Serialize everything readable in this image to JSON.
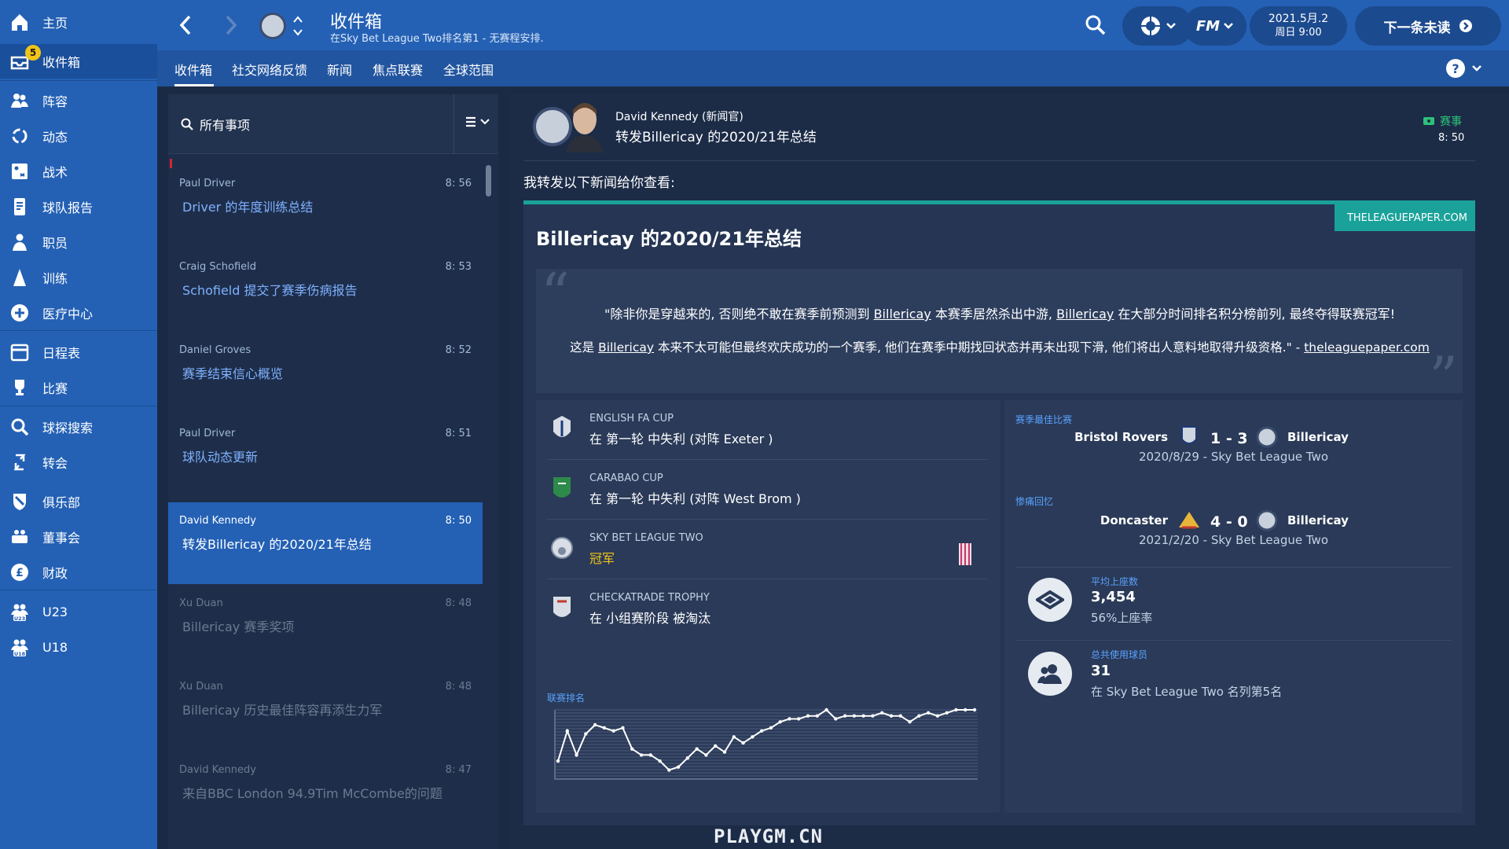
{
  "sidebar": {
    "items": [
      {
        "label": "主页",
        "icon": "home-icon"
      },
      {
        "label": "收件箱",
        "icon": "inbox-icon",
        "badge": "5"
      },
      {
        "label": "阵容",
        "icon": "squad-icon"
      },
      {
        "label": "动态",
        "icon": "dynamics-icon"
      },
      {
        "label": "战术",
        "icon": "tactics-icon"
      },
      {
        "label": "球队报告",
        "icon": "report-icon"
      },
      {
        "label": "职员",
        "icon": "staff-icon"
      },
      {
        "label": "训练",
        "icon": "training-icon"
      },
      {
        "label": "医疗中心",
        "icon": "medical-icon"
      },
      {
        "label": "日程表",
        "icon": "calendar-icon"
      },
      {
        "label": "比赛",
        "icon": "trophy-icon"
      },
      {
        "label": "球探搜索",
        "icon": "search-icon"
      },
      {
        "label": "转会",
        "icon": "transfer-icon"
      },
      {
        "label": "俱乐部",
        "icon": "club-icon"
      },
      {
        "label": "董事会",
        "icon": "board-icon"
      },
      {
        "label": "财政",
        "icon": "finance-icon"
      },
      {
        "label": "U23",
        "icon": "u23-icon"
      },
      {
        "label": "U18",
        "icon": "u18-icon"
      }
    ]
  },
  "header": {
    "title": "收件箱",
    "subtitle": "在Sky Bet League Two排名第1 - 无赛程安排.",
    "date": "2021.5月.2",
    "time": "周日 9:00",
    "next_label": "下一条未读",
    "fm_label": "FM"
  },
  "tabs": [
    "收件箱",
    "社交网络反馈",
    "新闻",
    "焦点联赛",
    "全球范围"
  ],
  "inbox": {
    "search_label": "所有事项",
    "messages": [
      {
        "from": "Paul Driver",
        "time": "8: 56",
        "subject": "Driver 的年度训练总结",
        "state": "unread"
      },
      {
        "from": "Craig Schofield",
        "time": "8: 53",
        "subject": "Schofield 提交了赛季伤病报告",
        "state": "unread"
      },
      {
        "from": "Daniel Groves",
        "time": "8: 52",
        "subject": "赛季结束信心概览",
        "state": "unread"
      },
      {
        "from": "Paul Driver",
        "time": "8: 51",
        "subject": "球队动态更新",
        "state": "unread"
      },
      {
        "from": "David Kennedy",
        "time": "8: 50",
        "subject": "转发Billericay 的2020/21年总结",
        "state": "selected"
      },
      {
        "from": "Xu Duan",
        "time": "8: 48",
        "subject": "Billericay 赛季奖项",
        "state": "read"
      },
      {
        "from": "Xu Duan",
        "time": "8: 48",
        "subject": "Billericay 历史最佳阵容再添生力军",
        "state": "read"
      },
      {
        "from": "David Kennedy",
        "time": "8: 47",
        "subject": "来自BBC London 94.9Tim McCombe的问题",
        "state": "read"
      }
    ]
  },
  "detail": {
    "sender": "David Kennedy (新闻官)",
    "subject": "转发Billericay 的2020/21年总结",
    "category": "赛事",
    "time": "8: 50",
    "intro": "我转发以下新闻给你查看:",
    "source": "THELEAGUEPAPER.COM",
    "article_title": "Billericay 的2020/21年总结",
    "quote1_parts": [
      "\"除非你是穿越来的, 否则绝不敢在赛季前预测到 ",
      "Billericay",
      " 本赛季居然杀出中游, ",
      "Billericay",
      " 在大部分时间排名积分榜前列, 最终夺得联赛冠军!"
    ],
    "quote2_parts": [
      "这是 ",
      "Billericay",
      " 本来不太可能但最终欢庆成功的一个赛季, 他们在赛季中期找回状态并再未出现下滑, 他们将出人意料地取得升级资格.\" - ",
      "theleaguepaper.com"
    ]
  },
  "honours": [
    {
      "competition": "ENGLISH FA CUP",
      "result": "在 第一轮 中失利 (对阵 Exeter )",
      "highlight": false
    },
    {
      "competition": "CARABAO CUP",
      "result": "在 第一轮 中失利 (对阵 West Brom )",
      "highlight": false
    },
    {
      "competition": "SKY BET LEAGUE TWO",
      "result": "冠军",
      "highlight": true
    },
    {
      "competition": "CHECKATRADE TROPHY",
      "result": "在 小组赛阶段 被淘汰",
      "highlight": false
    }
  ],
  "chart_data": {
    "type": "line",
    "title": "联赛排名",
    "xlabel": "",
    "ylabel": "",
    "x": [
      1,
      2,
      3,
      4,
      5,
      6,
      7,
      8,
      9,
      10,
      11,
      12,
      13,
      14,
      15,
      16,
      17,
      18,
      19,
      20,
      21,
      22,
      23,
      24,
      25,
      26,
      27,
      28,
      29,
      30,
      31,
      32,
      33,
      34,
      35,
      36,
      37,
      38,
      39,
      40,
      41,
      42,
      43,
      44,
      45,
      46
    ],
    "y": [
      18,
      8,
      16,
      9,
      6,
      7,
      8,
      7,
      14,
      16,
      16,
      18,
      21,
      20,
      17,
      14,
      16,
      13,
      15,
      10,
      12,
      10,
      8,
      7,
      5,
      4,
      4,
      3,
      3,
      1,
      4,
      3,
      3,
      3,
      3,
      2,
      3,
      3,
      5,
      3,
      2,
      3,
      2,
      1,
      1,
      1
    ],
    "y_inverted": true,
    "ylim": [
      1,
      24
    ],
    "colors": {
      "line": "#ffffff",
      "grid": "#4a5a78"
    }
  },
  "stats": {
    "best_label": "赛季最佳比赛",
    "best": {
      "home": "Bristol Rovers",
      "score": "1 - 3",
      "away": "Billericay",
      "info": "2020/8/29  -  Sky Bet League Two"
    },
    "worst_label": "惨痛回忆",
    "worst": {
      "home": "Doncaster",
      "score": "4 - 0",
      "away": "Billericay",
      "info": "2021/2/20  -  Sky Bet League Two"
    },
    "attendance_label": "平均上座数",
    "attendance_value": "3,454",
    "attendance_rate": "56%上座率",
    "players_label": "总共使用球员",
    "players_value": "31",
    "players_rank": "在 Sky Bet League Two 名列第5名"
  },
  "watermark": "PLAYGM.CN",
  "colors": {
    "sidebar": "#2461b5",
    "accent_teal": "#1aa29a",
    "champion": "#f0c419",
    "link_blue": "#5aa2ff"
  }
}
